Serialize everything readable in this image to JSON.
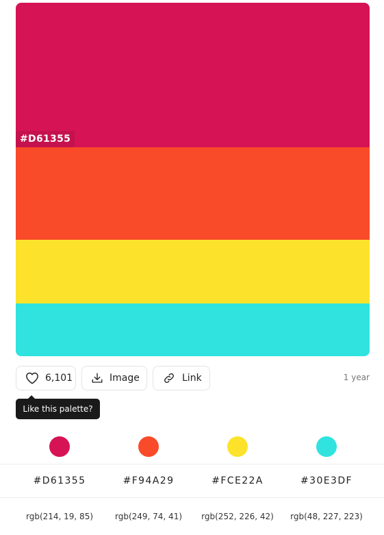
{
  "palette": {
    "overlay_hex": "#D61355",
    "colors": [
      {
        "hex": "#D61355",
        "rgb": "rgb(214, 19, 85)",
        "color": "#D61355"
      },
      {
        "hex": "#F94A29",
        "rgb": "rgb(249, 74, 41)",
        "color": "#F94A29"
      },
      {
        "hex": "#FCE22A",
        "rgb": "rgb(252, 226, 42)",
        "color": "#FCE22A"
      },
      {
        "hex": "#30E3DF",
        "rgb": "rgb(48, 227, 223)",
        "color": "#30E3DF"
      }
    ]
  },
  "actions": {
    "like_count": "6,101",
    "image_label": "Image",
    "link_label": "Link",
    "time_ago": "1 year"
  },
  "tooltip": {
    "text": "Like this palette?"
  },
  "icons": {
    "like": "heart-icon",
    "image": "download-icon",
    "link": "link-icon"
  }
}
